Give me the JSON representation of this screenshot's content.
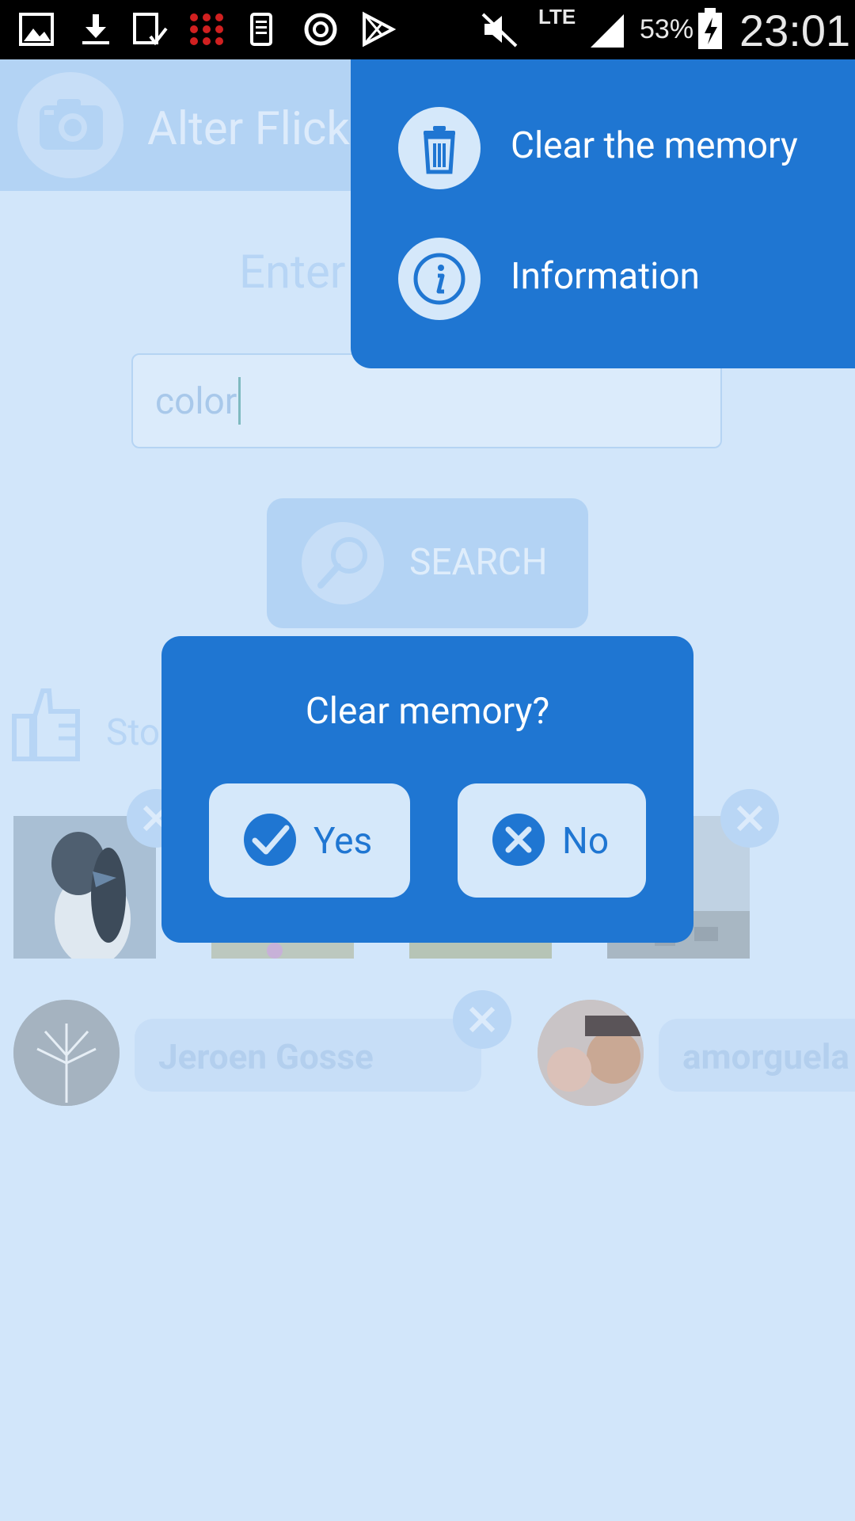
{
  "status_bar": {
    "battery": "53%",
    "time": "23:01",
    "network": "LTE",
    "icons": [
      "gallery-icon",
      "download-icon",
      "tablet-check-icon",
      "dots-grid-icon",
      "phone-doc-icon",
      "sync-icon",
      "play-store-icon",
      "mute-icon",
      "lte-icon",
      "signal-icon",
      "battery-charging-icon"
    ]
  },
  "app": {
    "title_visible": "Alter Flick",
    "prompt_visible": "Enter",
    "search_value": "color",
    "search_button": "SEARCH",
    "stories_label_visible": "Sto"
  },
  "users": [
    {
      "name": "Jeroen Gosse"
    },
    {
      "name": "amorguela"
    }
  ],
  "menu": {
    "items": [
      {
        "label": "Clear the memory",
        "icon": "trash-icon"
      },
      {
        "label": "Information",
        "icon": "info-icon"
      }
    ]
  },
  "dialog": {
    "title": "Clear memory?",
    "yes_label": "Yes",
    "no_label": "No"
  },
  "colors": {
    "accent": "#1f76d2",
    "background": "#d2e6fa",
    "button_fill": "#d5e8fa"
  }
}
